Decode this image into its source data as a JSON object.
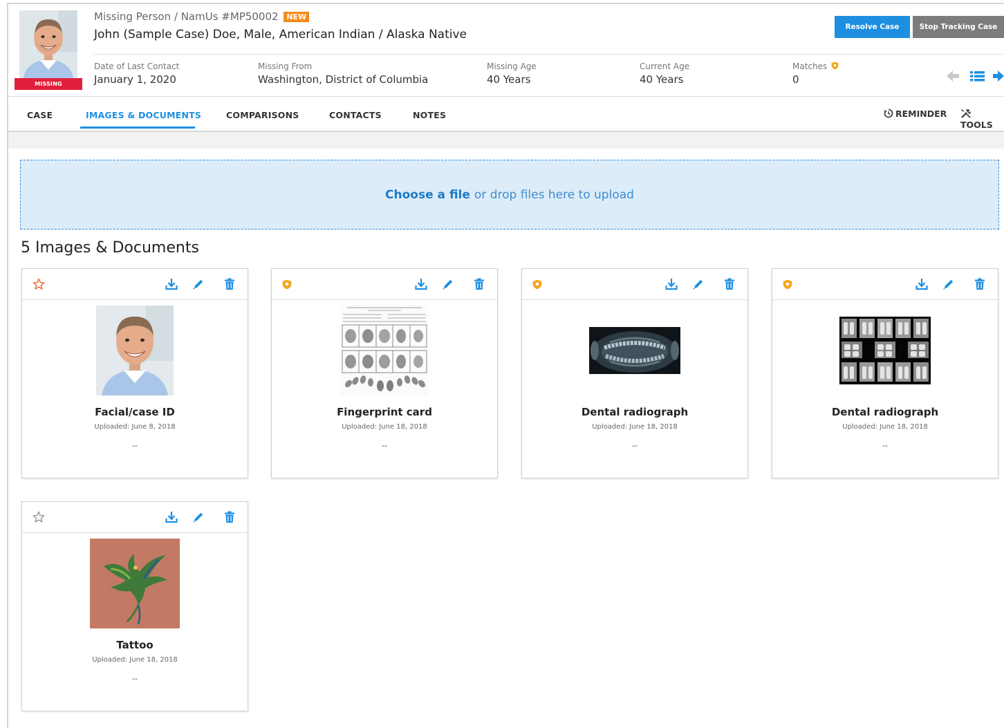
{
  "header": {
    "case_line": "Missing Person / NamUs #MP50002",
    "new_tag": "NEW",
    "person_name": "John (Sample Case) Doe, Male, American Indian / Alaska Native",
    "status_badge": "MISSING",
    "buttons": {
      "resolve": "Resolve Case",
      "stop_tracking": "Stop Tracking Case"
    },
    "meta": [
      {
        "label": "Date of Last Contact",
        "value": "January 1, 2020"
      },
      {
        "label": "Missing From",
        "value": "Washington, District of Columbia"
      },
      {
        "label": "Missing Age",
        "value": "40 Years"
      },
      {
        "label": "Current Age",
        "value": "40 Years"
      },
      {
        "label": "Matches",
        "value": "0"
      }
    ]
  },
  "tabs": [
    {
      "label": "CASE"
    },
    {
      "label": "IMAGES & DOCUMENTS",
      "active": true
    },
    {
      "label": "COMPARISONS"
    },
    {
      "label": "CONTACTS"
    },
    {
      "label": "NOTES"
    }
  ],
  "tab_actions": {
    "reminder": "REMINDER",
    "tools": "TOOLS"
  },
  "upload": {
    "choose_label": "Choose a file",
    "drop_text": "or drop files here to upload"
  },
  "section_title": "5 Images & Documents",
  "documents": [
    {
      "title": "Facial/case ID",
      "uploaded": "Uploaded: June 8, 2018",
      "description": "--",
      "badge": "star-outline-orange"
    },
    {
      "title": "Fingerprint card",
      "uploaded": "Uploaded: June 18, 2018",
      "description": "--",
      "badge": "shield-icon"
    },
    {
      "title": "Dental radiograph",
      "uploaded": "Uploaded: June 18, 2018",
      "description": "--",
      "badge": "shield-icon"
    },
    {
      "title": "Dental radiograph",
      "uploaded": "Uploaded: June 18, 2018",
      "description": "--",
      "badge": "shield-icon"
    },
    {
      "title": "Tattoo",
      "uploaded": "Uploaded: June 18, 2018",
      "description": "--",
      "badge": "star-outline-gray"
    }
  ],
  "colors": {
    "accent": "#1e8fe0",
    "missing_badge": "#e0203a",
    "new_tag": "#f38a1c",
    "shield": "#f5a623",
    "dropzone_bg": "#dcecf8"
  }
}
